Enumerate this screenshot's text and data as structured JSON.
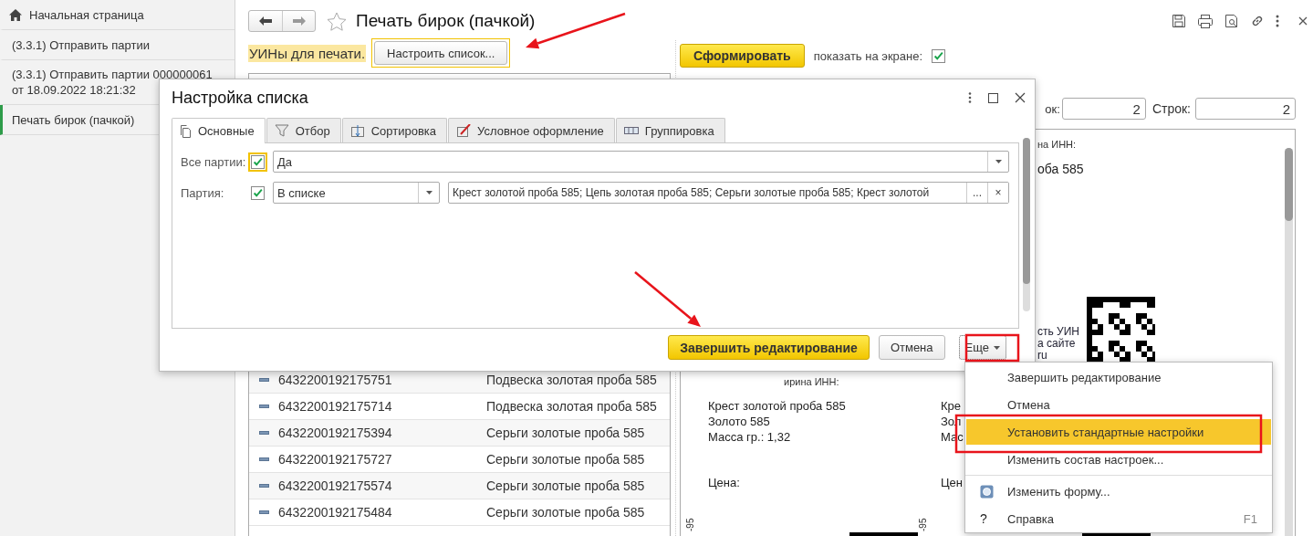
{
  "sidebar": {
    "items": [
      {
        "kind": "home",
        "label": "Начальная страница",
        "selected": false
      },
      {
        "kind": "form",
        "label": "(3.3.1) Отправить партии",
        "selected": false
      },
      {
        "kind": "form",
        "label": "(3.3.1) Отправить партии 000000061 от 18.09.2022 18:21:32",
        "selected": false
      },
      {
        "kind": "form",
        "label": "Печать бирок (пачкой)",
        "selected": true
      }
    ]
  },
  "form": {
    "title": "Печать бирок (пачкой)",
    "favorite": false,
    "uins_label": "УИНы для печати.",
    "configure_button": {
      "label": "Настроить список...",
      "focused": true
    },
    "generate_button": "Сформировать",
    "show_on_screen": {
      "label": "показать на экране:",
      "checked": true
    },
    "columns_label": "ок:",
    "columns_value": "2",
    "rows_label": "Строк:",
    "rows_value": "2"
  },
  "table": {
    "rows": [
      {
        "uin": "6432200192175751",
        "name": "Подвеска золотая проба 585"
      },
      {
        "uin": "6432200192175714",
        "name": "Подвеска золотая проба 585"
      },
      {
        "uin": "6432200192175394",
        "name": "Серьги золотые проба 585"
      },
      {
        "uin": "6432200192175727",
        "name": "Серьги золотые проба 585"
      },
      {
        "uin": "6432200192175574",
        "name": "Серьги золотые проба 585"
      },
      {
        "uin": "6432200192175484",
        "name": "Серьги золотые проба 585"
      }
    ]
  },
  "preview": {
    "upper_texts": [
      "на ИНН:",
      "оба 585"
    ],
    "upper_note": [
      "сть УИН",
      "а сайте",
      "ru"
    ],
    "labels": [
      {
        "header": "ирина ИНН:",
        "lines": [
          "Крест золотой проба 585",
          "Золото 585",
          "Масса гр.: 1,32"
        ],
        "price": "Цена:",
        "side": "-95"
      },
      {
        "lines": [
          "Кре",
          "Зол",
          "Мас"
        ],
        "price": "Цен",
        "side": "-95"
      }
    ]
  },
  "dialog": {
    "title": "Настройка списка",
    "tabs": [
      {
        "kind": "main",
        "label": "Основные",
        "selected": true
      },
      {
        "kind": "filter",
        "label": "Отбор",
        "selected": false
      },
      {
        "kind": "sort",
        "label": "Сортировка",
        "selected": false
      },
      {
        "kind": "appearance",
        "label": "Условное оформление",
        "selected": false
      },
      {
        "kind": "grouping",
        "label": "Группировка",
        "selected": false
      }
    ],
    "rows": [
      {
        "kind": "single",
        "label": "Все партии:",
        "checked": true,
        "focused": true,
        "value": "Да"
      },
      {
        "kind": "list",
        "label": "Партия:",
        "checked": true,
        "focused": false,
        "condition": "В списке",
        "value": "Крест золотой проба 585; Цепь золотая проба 585; Серьги золотые проба 585; Крест золотой",
        "more": "...",
        "clear": "×"
      }
    ],
    "buttons": {
      "finish": "Завершить редактирование",
      "cancel": "Отмена",
      "more": "Еще"
    }
  },
  "menu": {
    "items": [
      {
        "kind": "plain",
        "label": "Завершить редактирование",
        "selected": false
      },
      {
        "kind": "plain",
        "label": "Отмена",
        "selected": false
      },
      {
        "kind": "plain",
        "label": "Установить стандартные настройки",
        "selected": true
      },
      {
        "kind": "plain",
        "label": "Изменить состав настроек...",
        "selected": false,
        "separator_after": true
      },
      {
        "kind": "form",
        "label": "Изменить форму...",
        "selected": false
      },
      {
        "kind": "help",
        "icon": "?",
        "label": "Справка",
        "shortcut": "F1",
        "selected": false
      }
    ]
  }
}
